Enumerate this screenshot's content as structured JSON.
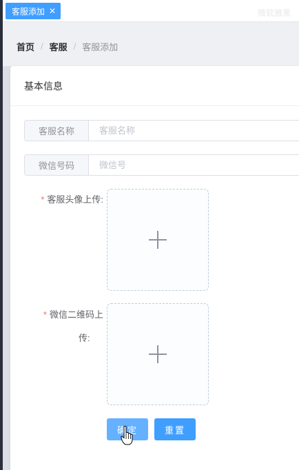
{
  "tabs": [
    {
      "label": "客服添加",
      "close": "✕"
    }
  ],
  "watermark": "微软雅黑",
  "breadcrumb": {
    "home": "首页",
    "section": "客服",
    "current": "客服添加",
    "separator": "/"
  },
  "panel": {
    "title": "基本信息"
  },
  "form": {
    "name": {
      "prepend": "客服名称",
      "placeholder": "客服名称",
      "value": ""
    },
    "wechat": {
      "prepend": "微信号码",
      "placeholder": "微信号",
      "value": ""
    },
    "avatar_upload": {
      "required_mark": "*",
      "label": "客服头像上传:"
    },
    "qrcode_upload": {
      "required_mark": "*",
      "label_line1": "微信二维码上",
      "label_line2": "传:"
    },
    "confirm_label": "确定",
    "reset_label": "重置"
  },
  "colors": {
    "primary": "#409eff",
    "primary_light": "#66b1ff",
    "required": "#f56c6c",
    "sidebar": "#2b2f3a"
  }
}
